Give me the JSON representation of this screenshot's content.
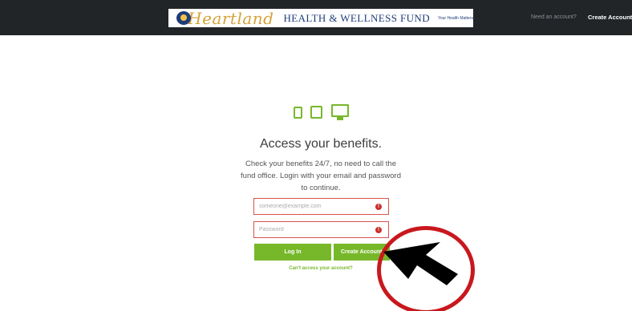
{
  "header": {
    "logo": {
      "word": "Heartland",
      "subtitle": "HEALTH & WELLNESS FUND",
      "tagline": "Your Health Matters",
      "icon": "heartland-logo-mark"
    },
    "need_account": "Need an account?",
    "create_account": "Create Account"
  },
  "main": {
    "device_icons": [
      "phone-icon",
      "tablet-icon",
      "monitor-icon"
    ],
    "title": "Access your benefits.",
    "description": "Check your benefits 24/7, no need to call the fund office. Login with your email and password to continue.",
    "email_placeholder": "someone@example.com",
    "password_placeholder": "Password",
    "error_icon": "!",
    "login_label": "Log In",
    "create_label": "Create Account",
    "cant_access": "Can't access your account?"
  },
  "annotation": {
    "circle_color": "#c8181e",
    "arrow_color": "#000000"
  },
  "colors": {
    "accent": "#77b82a",
    "topbar": "#222528",
    "error": "#d9534f"
  }
}
